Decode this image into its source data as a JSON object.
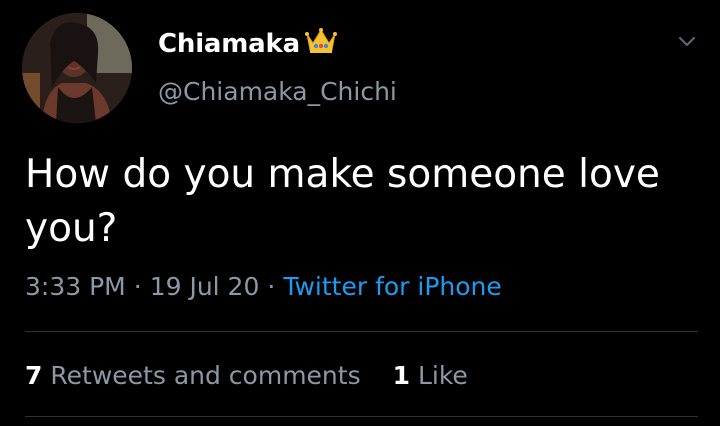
{
  "tweet": {
    "display_name": "Chiamaka",
    "name_icon": "crown-emoji-icon",
    "handle": "@Chiamaka_Chichi",
    "text": "How do you make someone love you?",
    "time": "3:33 PM",
    "date": "19 Jul 20",
    "source": "Twitter for iPhone",
    "separator": "·",
    "menu_icon": "chevron-down-icon"
  },
  "stats": {
    "retweets_count": "7",
    "retweets_label": "Retweets and comments",
    "likes_count": "1",
    "likes_label": "Like"
  },
  "colors": {
    "background": "#000000",
    "primary_text": "#ffffff",
    "secondary_text": "#8b98a5",
    "link": "#1d9bf0",
    "divider": "#2f3336"
  }
}
